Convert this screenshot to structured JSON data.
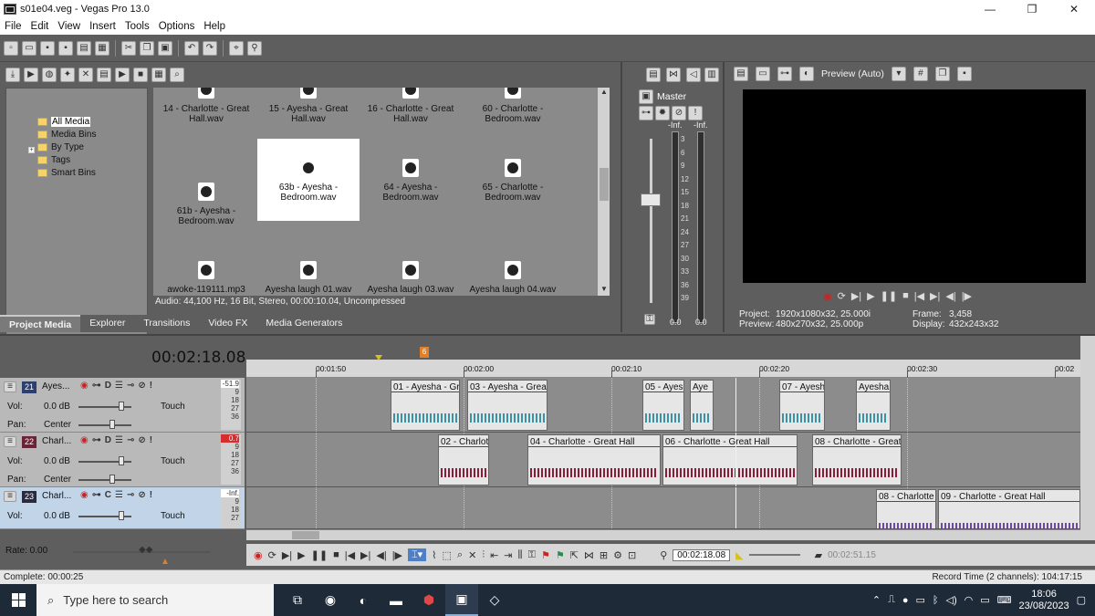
{
  "window": {
    "title": "s01e04.veg - Vegas Pro 13.0",
    "controls": [
      "—",
      "❐",
      "✕"
    ]
  },
  "menu": [
    "File",
    "Edit",
    "View",
    "Insert",
    "Tools",
    "Options",
    "Help"
  ],
  "media": {
    "tree": [
      "All Media",
      "Media Bins",
      "By Type",
      "Tags",
      "Smart Bins"
    ],
    "tiles": [
      {
        "label": "14 - Charlotte - Great Hall.wav"
      },
      {
        "label": "15 - Ayesha - Great Hall.wav"
      },
      {
        "label": "16 - Charlotte - Great Hall.wav"
      },
      {
        "label": "60 - Charlotte - Bedroom.wav"
      },
      {
        "label": "61b - Ayesha - Bedroom.wav"
      },
      {
        "label": "63b - Ayesha - Bedroom.wav"
      },
      {
        "label": "64 - Ayesha - Bedroom.wav"
      },
      {
        "label": "65 - Charlotte - Bedroom.wav"
      },
      {
        "label": "awoke-119111.mp3"
      },
      {
        "label": "Ayesha laugh 01.wav"
      },
      {
        "label": "Ayesha laugh 03.wav"
      },
      {
        "label": "Ayesha laugh 04.wav"
      }
    ],
    "status": "Audio: 44,100 Hz, 16 Bit, Stereo, 00:00:10.04, Uncompressed",
    "tabs": [
      "Project Media",
      "Explorer",
      "Transitions",
      "Video FX",
      "Media Generators"
    ]
  },
  "master": {
    "label": "Master",
    "inf_left": "-Inf.",
    "inf_right": "-Inf.",
    "scale": [
      "3",
      "6",
      "9",
      "12",
      "15",
      "18",
      "21",
      "24",
      "27",
      "30",
      "33",
      "36",
      "39"
    ],
    "val_left": "0.0",
    "val_right": "0.0"
  },
  "preview": {
    "mode": "Preview (Auto)",
    "project_label": "Project:",
    "project_value": "1920x1080x32, 25.000i",
    "preview_label": "Preview:",
    "preview_value": "480x270x32, 25.000p",
    "frame_label": "Frame:",
    "frame_value": "3,458",
    "display_label": "Display:",
    "display_value": "432x243x32"
  },
  "timeline": {
    "timecode": "00:02:18.08",
    "ruler": [
      "00:01:50",
      "00:02:00",
      "00:02:10",
      "00:02:20",
      "00:02:30",
      "00:02"
    ],
    "marker": "6",
    "tracks": [
      {
        "num": "21",
        "name": "Ayes...",
        "mode": "Touch",
        "vol_label": "Vol:",
        "vol": "0.0 dB",
        "pan_label": "Pan:",
        "pan": "Center",
        "meter_top": "-51.9",
        "letter": "D",
        "clips": [
          {
            "title": "01 - Ayesha - Gre"
          },
          {
            "title": "03 - Ayesha - Great"
          },
          {
            "title": "05 - Ayes"
          },
          {
            "title": "Aye"
          },
          {
            "title": "07 - Ayesh"
          },
          {
            "title": "Ayesha"
          }
        ]
      },
      {
        "num": "22",
        "name": "Charl...",
        "mode": "Touch",
        "vol_label": "Vol:",
        "vol": "0.0 dB",
        "pan_label": "Pan:",
        "pan": "Center",
        "meter_top": "0.7",
        "letter": "D",
        "clips": [
          {
            "title": "02 - Charlot"
          },
          {
            "title": "04 - Charlotte - Great Hall"
          },
          {
            "title": "06 - Charlotte - Great Hall"
          },
          {
            "title": "08 - Charlotte - Great"
          }
        ]
      },
      {
        "num": "23",
        "name": "Charl...",
        "mode": "Touch",
        "vol_label": "Vol:",
        "vol": "0.0 dB",
        "pan_label": "",
        "pan": "",
        "meter_top": "-Inf.",
        "letter": "C",
        "clips": [
          {
            "title": "08 - Charlotte"
          },
          {
            "title": "09 - Charlotte - Great Hall"
          }
        ]
      }
    ],
    "meter_scale": [
      "9",
      "18",
      "27",
      "36"
    ],
    "rate": "Rate: 0.00",
    "transport_time": "00:02:18.08",
    "transport_end": "00:02:51.15"
  },
  "status": {
    "left": "Complete: 00:00:25",
    "right": "Record Time (2 channels): 104:17:15"
  },
  "taskbar": {
    "search_placeholder": "Type here to search",
    "time": "18:06",
    "date": "23/08/2023"
  }
}
